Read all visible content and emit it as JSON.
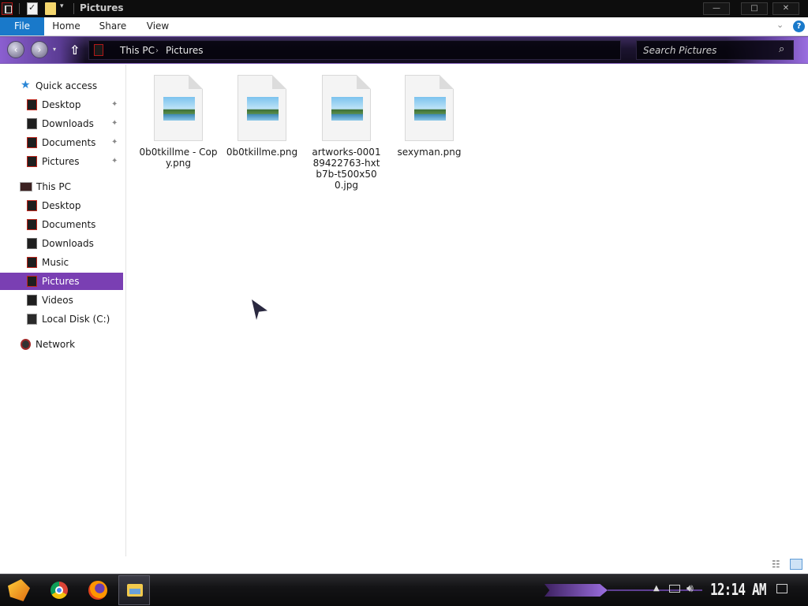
{
  "window": {
    "title": "Pictures",
    "controls": {
      "minimize": "—",
      "maximize": "□",
      "close": "✕"
    }
  },
  "ribbon": {
    "tabs": [
      "File",
      "Home",
      "Share",
      "View"
    ],
    "help": "?"
  },
  "navigation": {
    "up_glyph": "⇧",
    "breadcrumb": [
      "This PC",
      "Pictures"
    ],
    "breadcrumb_separator": "›",
    "search_placeholder": "Search Pictures",
    "search_icon": "⌕"
  },
  "sidebar": {
    "quick_access": {
      "label": "Quick access",
      "items": [
        {
          "label": "Desktop",
          "pinned": true
        },
        {
          "label": "Downloads",
          "pinned": true
        },
        {
          "label": "Documents",
          "pinned": true
        },
        {
          "label": "Pictures",
          "pinned": true
        }
      ]
    },
    "this_pc": {
      "label": "This PC",
      "items": [
        {
          "label": "Desktop"
        },
        {
          "label": "Documents"
        },
        {
          "label": "Downloads"
        },
        {
          "label": "Music"
        },
        {
          "label": "Pictures",
          "selected": true
        },
        {
          "label": "Videos"
        },
        {
          "label": "Local Disk (C:)"
        }
      ]
    },
    "network": {
      "label": "Network"
    },
    "pin_glyph": "📌"
  },
  "files": [
    {
      "name": "0b0tkillme - Copy.png"
    },
    {
      "name": "0b0tkillme.png"
    },
    {
      "name": "artworks-000189422763-hxtb7b-t500x500.jpg"
    },
    {
      "name": "sexyman.png"
    }
  ],
  "taskbar": {
    "clock": "12:14 AM",
    "pinned_apps": [
      "start-icon",
      "chrome-icon",
      "firefox-icon",
      "file-explorer-icon"
    ]
  },
  "colors": {
    "accent_file_tab": "#1979ca",
    "selection_purple": "#7a3fb3",
    "nav_bar_purple": "#5b3c94"
  }
}
